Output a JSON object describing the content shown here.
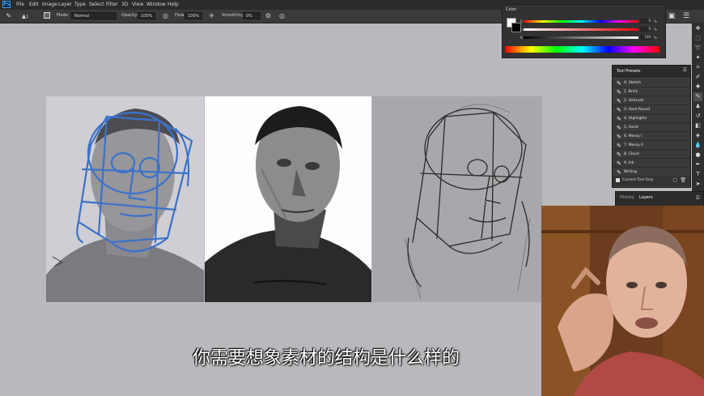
{
  "menubar": {
    "app_logo": "Ps",
    "items": [
      "File",
      "Edit",
      "Image",
      "Layer",
      "Type",
      "Select",
      "Filter",
      "3D",
      "View",
      "Window",
      "Help"
    ]
  },
  "options_bar": {
    "brush_size": "1",
    "mode_label": "Mode:",
    "mode_value": "Normal",
    "opacity_label": "Opacity:",
    "opacity_value": "100%",
    "flow_label": "Flow:",
    "flow_value": "100%",
    "smoothing_label": "Smoothing:",
    "smoothing_value": "0%"
  },
  "color_panel": {
    "title": "Color",
    "sliders": [
      {
        "label": "R",
        "value": "0",
        "unit": "%"
      },
      {
        "label": "G",
        "value": "0",
        "unit": "%"
      },
      {
        "label": "B",
        "value": "100",
        "unit": "%"
      }
    ]
  },
  "tool_presets": {
    "title": "Tool Presets",
    "items": [
      "0. Sketch",
      "1. Brick",
      "2. Airbrush",
      "3. Hard Round",
      "4. Highlights",
      "5. Hand",
      "6. Messy I",
      "7. Messy II",
      "8. Cloud",
      "9. Ink",
      "Writing"
    ],
    "current_tool_only": "Current Tool Only"
  },
  "layers_panel": {
    "tabs": [
      "History",
      "Layers"
    ]
  },
  "caption": {
    "text": "你需要想象素材的结构是什么样的"
  },
  "colors": {
    "ps_blue": "#2fa3f7",
    "construction_blue": "#3b72c9",
    "panel_bg": "#3a3a3a",
    "canvas_bg": "#b9b8bc"
  }
}
